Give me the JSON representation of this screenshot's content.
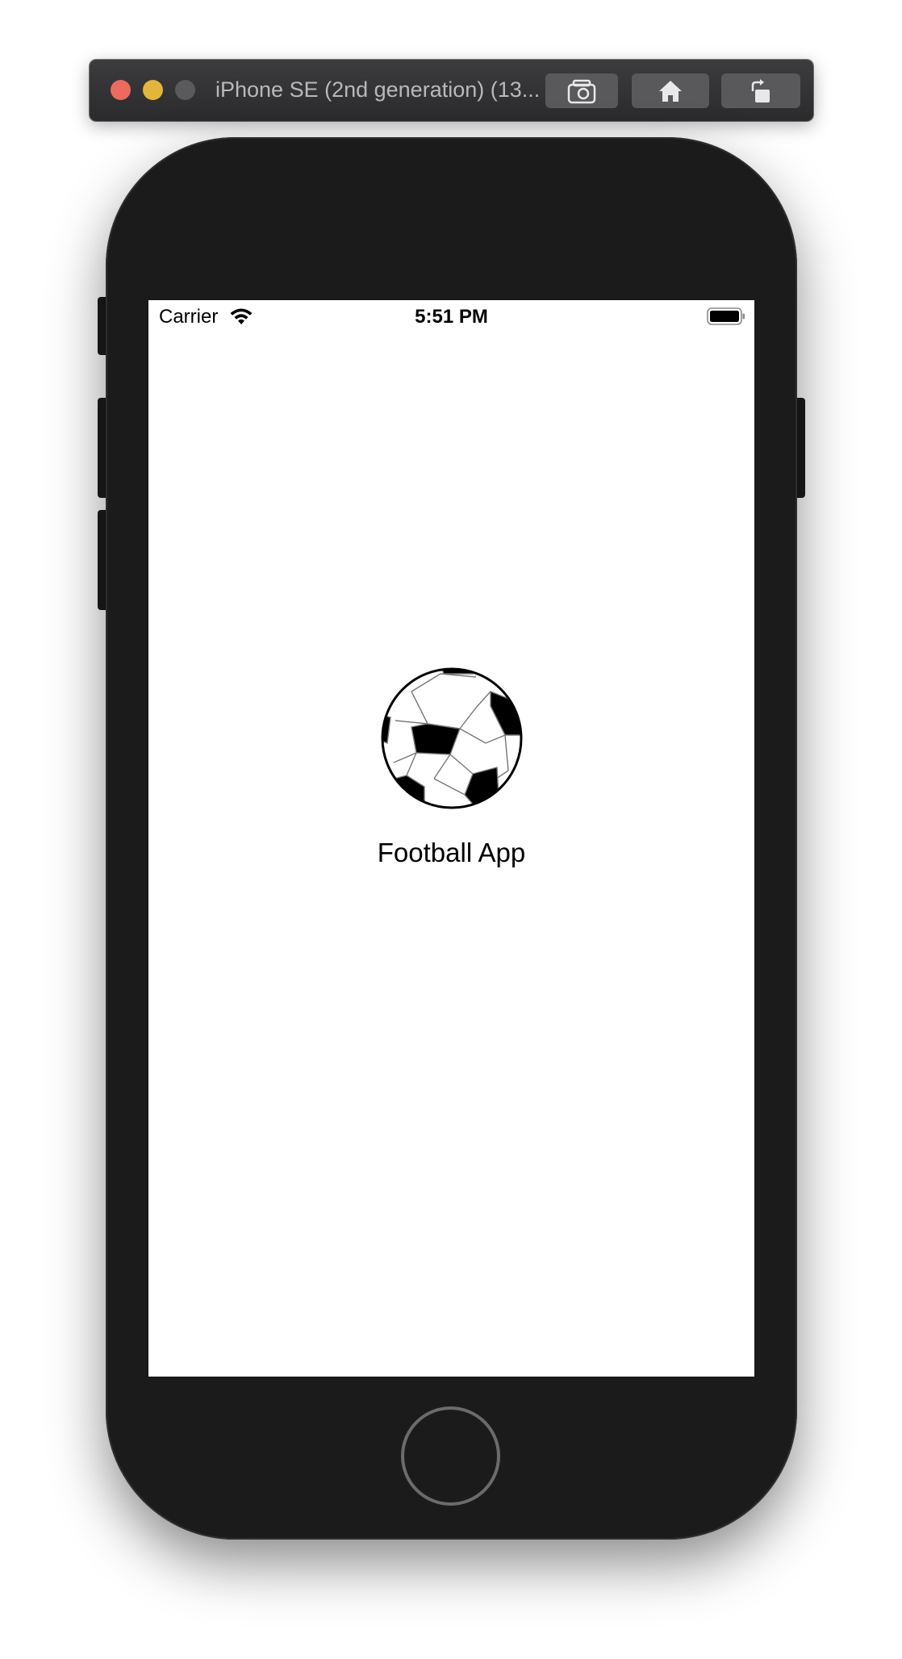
{
  "window": {
    "title": "iPhone SE (2nd generation) (13..."
  },
  "toolbar": {
    "buttons": [
      "screenshot-icon",
      "home-icon",
      "rotate-icon"
    ]
  },
  "status_bar": {
    "carrier": "Carrier",
    "time": "5:51 PM",
    "icons": [
      "wifi-icon",
      "battery-icon"
    ]
  },
  "splash": {
    "icon": "football-icon",
    "app_name": "Football App"
  },
  "colors": {
    "close": "#ed6a5e",
    "minimize": "#e3b53c",
    "zoom": "#5a5a5d",
    "device": "#1b1b1c"
  }
}
